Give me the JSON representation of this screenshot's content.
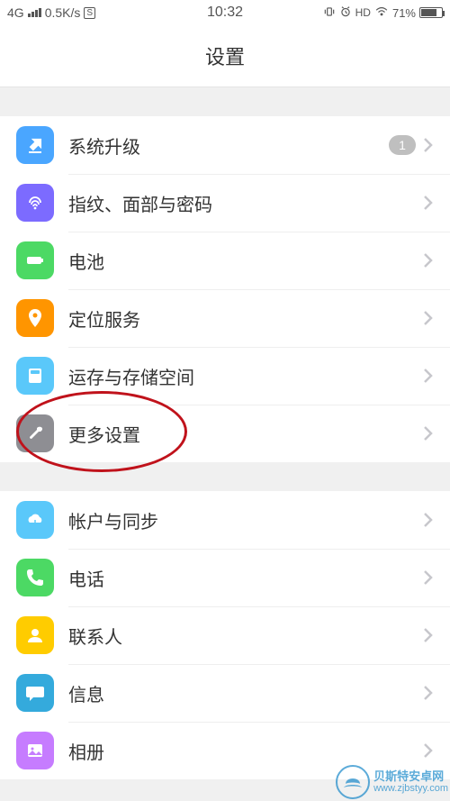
{
  "status": {
    "network": "4G",
    "speed": "0.5K/s",
    "sim": "S",
    "time": "10:32",
    "hd": "HD",
    "battery_pct": "71%"
  },
  "header": {
    "title": "设置"
  },
  "group1": {
    "items": [
      {
        "key": "system-update",
        "label": "系统升级",
        "icon_color": "#4aa6ff",
        "badge": "1"
      },
      {
        "key": "fingerprint-face-password",
        "label": "指纹、面部与密码",
        "icon_color": "#7c6bff"
      },
      {
        "key": "battery",
        "label": "电池",
        "icon_color": "#4cd964"
      },
      {
        "key": "location",
        "label": "定位服务",
        "icon_color": "#ff9500"
      },
      {
        "key": "storage",
        "label": "运存与存储空间",
        "icon_color": "#5ac8fa"
      },
      {
        "key": "more-settings",
        "label": "更多设置",
        "icon_color": "#8e8e93"
      }
    ]
  },
  "group2": {
    "items": [
      {
        "key": "account-sync",
        "label": "帐户与同步",
        "icon_color": "#5ac8fa"
      },
      {
        "key": "phone",
        "label": "电话",
        "icon_color": "#4cd964"
      },
      {
        "key": "contacts",
        "label": "联系人",
        "icon_color": "#ffcc00"
      },
      {
        "key": "messages",
        "label": "信息",
        "icon_color": "#34aadc"
      },
      {
        "key": "gallery",
        "label": "相册",
        "icon_color": "#c67cff"
      }
    ]
  },
  "watermark": {
    "line1": "贝斯特安卓网",
    "line2": "www.zjbstyy.com"
  }
}
